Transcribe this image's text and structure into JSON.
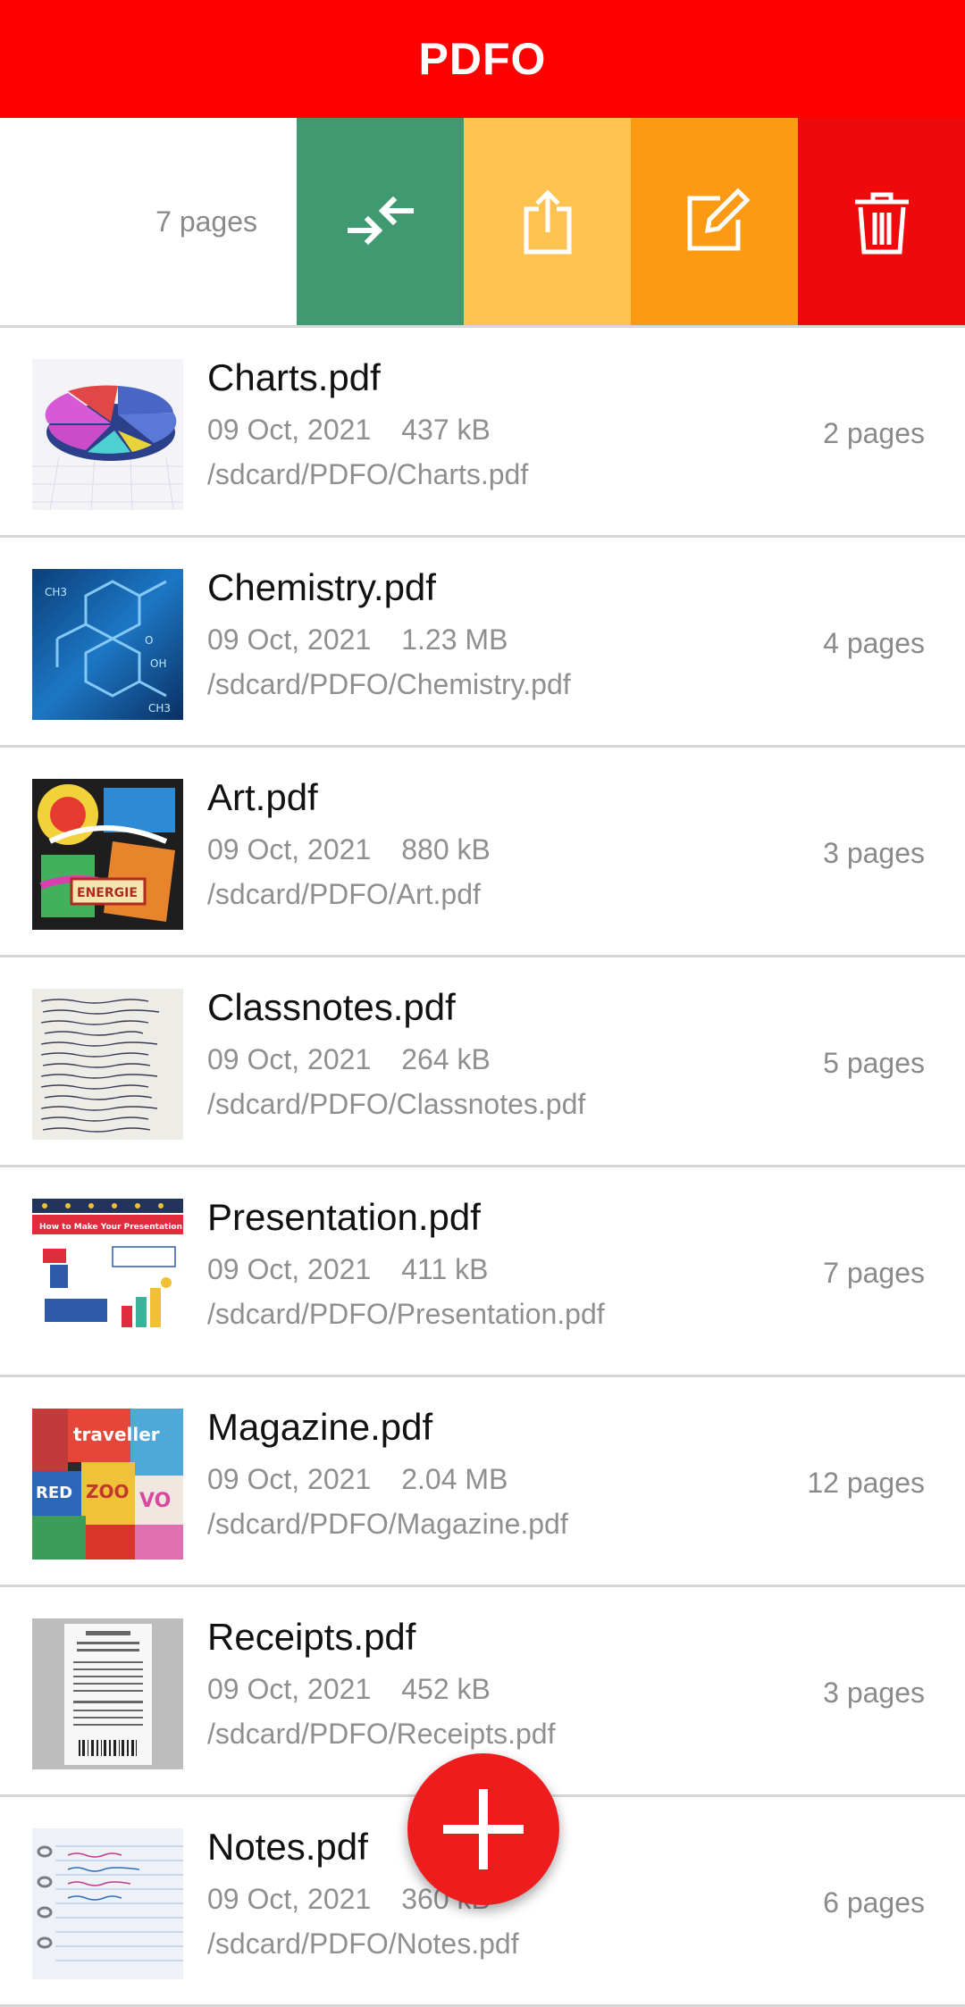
{
  "app": {
    "title": "PDFO"
  },
  "swipe_row": {
    "pages": "7 pages",
    "actions": [
      {
        "name": "compress",
        "icon": "compress-arrows-icon",
        "color": "#409A71"
      },
      {
        "name": "share",
        "icon": "share-upload-icon",
        "color": "#FEC34F"
      },
      {
        "name": "edit",
        "icon": "edit-pencil-icon",
        "color": "#FD9A14"
      },
      {
        "name": "delete",
        "icon": "trash-icon",
        "color": "#EE0A0A"
      }
    ]
  },
  "files": [
    {
      "name": "Charts.pdf",
      "date": "09 Oct, 2021",
      "size": "437 kB",
      "path": "/sdcard/PDFO/Charts.pdf",
      "pages": "2 pages",
      "thumbnail": "pie-chart-thumbnail"
    },
    {
      "name": "Chemistry.pdf",
      "date": "09 Oct, 2021",
      "size": "1.23 MB",
      "path": "/sdcard/PDFO/Chemistry.pdf",
      "pages": "4 pages",
      "thumbnail": "chemistry-molecule-thumbnail"
    },
    {
      "name": "Art.pdf",
      "date": "09 Oct, 2021",
      "size": "880 kB",
      "path": "/sdcard/PDFO/Art.pdf",
      "pages": "3 pages",
      "thumbnail": "graffiti-art-thumbnail"
    },
    {
      "name": "Classnotes.pdf",
      "date": "09 Oct, 2021",
      "size": "264 kB",
      "path": "/sdcard/PDFO/Classnotes.pdf",
      "pages": "5 pages",
      "thumbnail": "handwritten-notes-thumbnail"
    },
    {
      "name": "Presentation.pdf",
      "date": "09 Oct, 2021",
      "size": "411 kB",
      "path": "/sdcard/PDFO/Presentation.pdf",
      "pages": "7 pages",
      "thumbnail": "presentation-slide-thumbnail"
    },
    {
      "name": "Magazine.pdf",
      "date": "09 Oct, 2021",
      "size": "2.04 MB",
      "path": "/sdcard/PDFO/Magazine.pdf",
      "pages": "12 pages",
      "thumbnail": "magazine-covers-thumbnail"
    },
    {
      "name": "Receipts.pdf",
      "date": "09 Oct, 2021",
      "size": "452 kB",
      "path": "/sdcard/PDFO/Receipts.pdf",
      "pages": "3 pages",
      "thumbnail": "receipt-thumbnail"
    },
    {
      "name": "Notes.pdf",
      "date": "09 Oct, 2021",
      "size": "360 kB",
      "path": "/sdcard/PDFO/Notes.pdf",
      "pages": "6 pages",
      "thumbnail": "notebook-thumbnail"
    }
  ],
  "fab": {
    "icon": "plus-icon",
    "color": "#EE1C1C"
  },
  "colors": {
    "topbar": "#FF0000",
    "accent": "#EE1C1C"
  }
}
